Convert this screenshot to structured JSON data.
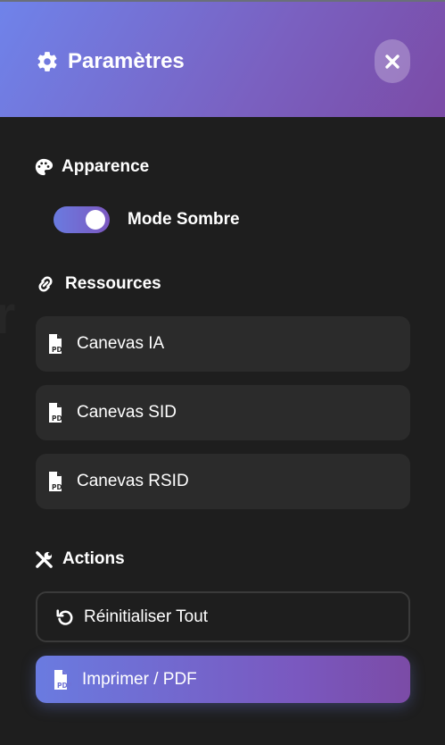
{
  "header": {
    "title": "Paramètres",
    "title_icon": "gear-icon",
    "close_icon": "close-icon"
  },
  "sections": {
    "appearance": {
      "title": "Apparence",
      "icon": "palette-icon",
      "dark_mode_label": "Mode Sombre",
      "dark_mode_on": true
    },
    "resources": {
      "title": "Ressources",
      "icon": "link-icon",
      "items": [
        {
          "label": "Canevas IA",
          "icon": "pdf-file-icon"
        },
        {
          "label": "Canevas SID",
          "icon": "pdf-file-icon"
        },
        {
          "label": "Canevas RSID",
          "icon": "pdf-file-icon"
        }
      ]
    },
    "actions": {
      "title": "Actions",
      "icon": "tools-icon",
      "reset_label": "Réinitialiser Tout",
      "reset_icon": "undo-icon",
      "print_label": "Imprimer / PDF",
      "print_icon": "pdf-file-icon"
    }
  },
  "colors": {
    "accent_start": "#6a7be0",
    "accent_end": "#7b4ba6",
    "background": "#1e1e1e",
    "card": "#2b2b2b"
  }
}
